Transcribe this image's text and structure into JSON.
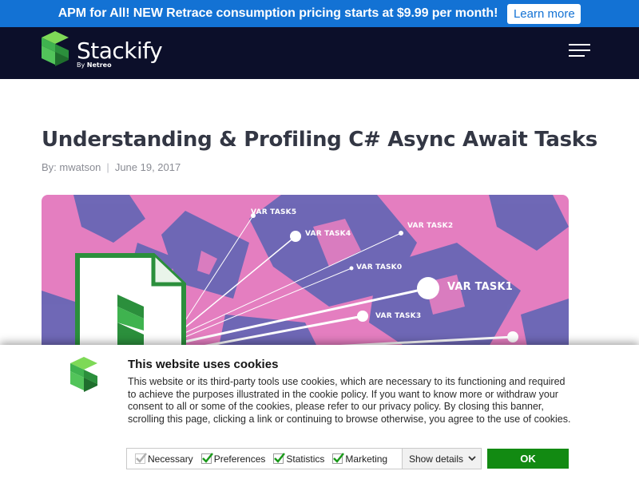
{
  "promo": {
    "text": "APM for All! NEW Retrace consumption pricing starts at $9.99 per month!",
    "button_label": "Learn more"
  },
  "header": {
    "logo_text": "Stackify",
    "logo_by": "By",
    "logo_by_brand": "Netreo",
    "menu_icon": "hamburger-menu-icon"
  },
  "article": {
    "title": "Understanding & Profiling C# Async Await Tasks",
    "author": "By: mwatson",
    "separator": "|",
    "date": "June 19, 2017",
    "hero_labels": [
      "VAR TASK5",
      "VAR TASK4",
      "VAR TASK2",
      "VAR TASK0",
      "VAR TASK1",
      "VAR TASK3"
    ]
  },
  "cookie": {
    "title": "This website uses cookies",
    "text": "This website or its third-party tools use cookies, which are necessary to its functioning and required to achieve the purposes illustrated in the cookie policy. If you want to know more or withdraw your consent to all or some of the cookies, please refer to our privacy policy. By closing this banner, scrolling this page, clicking a link or continuing to browse otherwise, you agree to the use of cookies.",
    "options": {
      "necessary": "Necessary",
      "preferences": "Preferences",
      "statistics": "Statistics",
      "marketing": "Marketing"
    },
    "show_details": "Show details",
    "ok_label": "OK"
  },
  "colors": {
    "promo_bg": "#1372d4",
    "header_bg": "#0c0f2a",
    "brand_green": "#3fb34f",
    "ok_green": "#128a12",
    "hero_pink": "#e47ec0",
    "hero_blue": "#5a64b4"
  }
}
